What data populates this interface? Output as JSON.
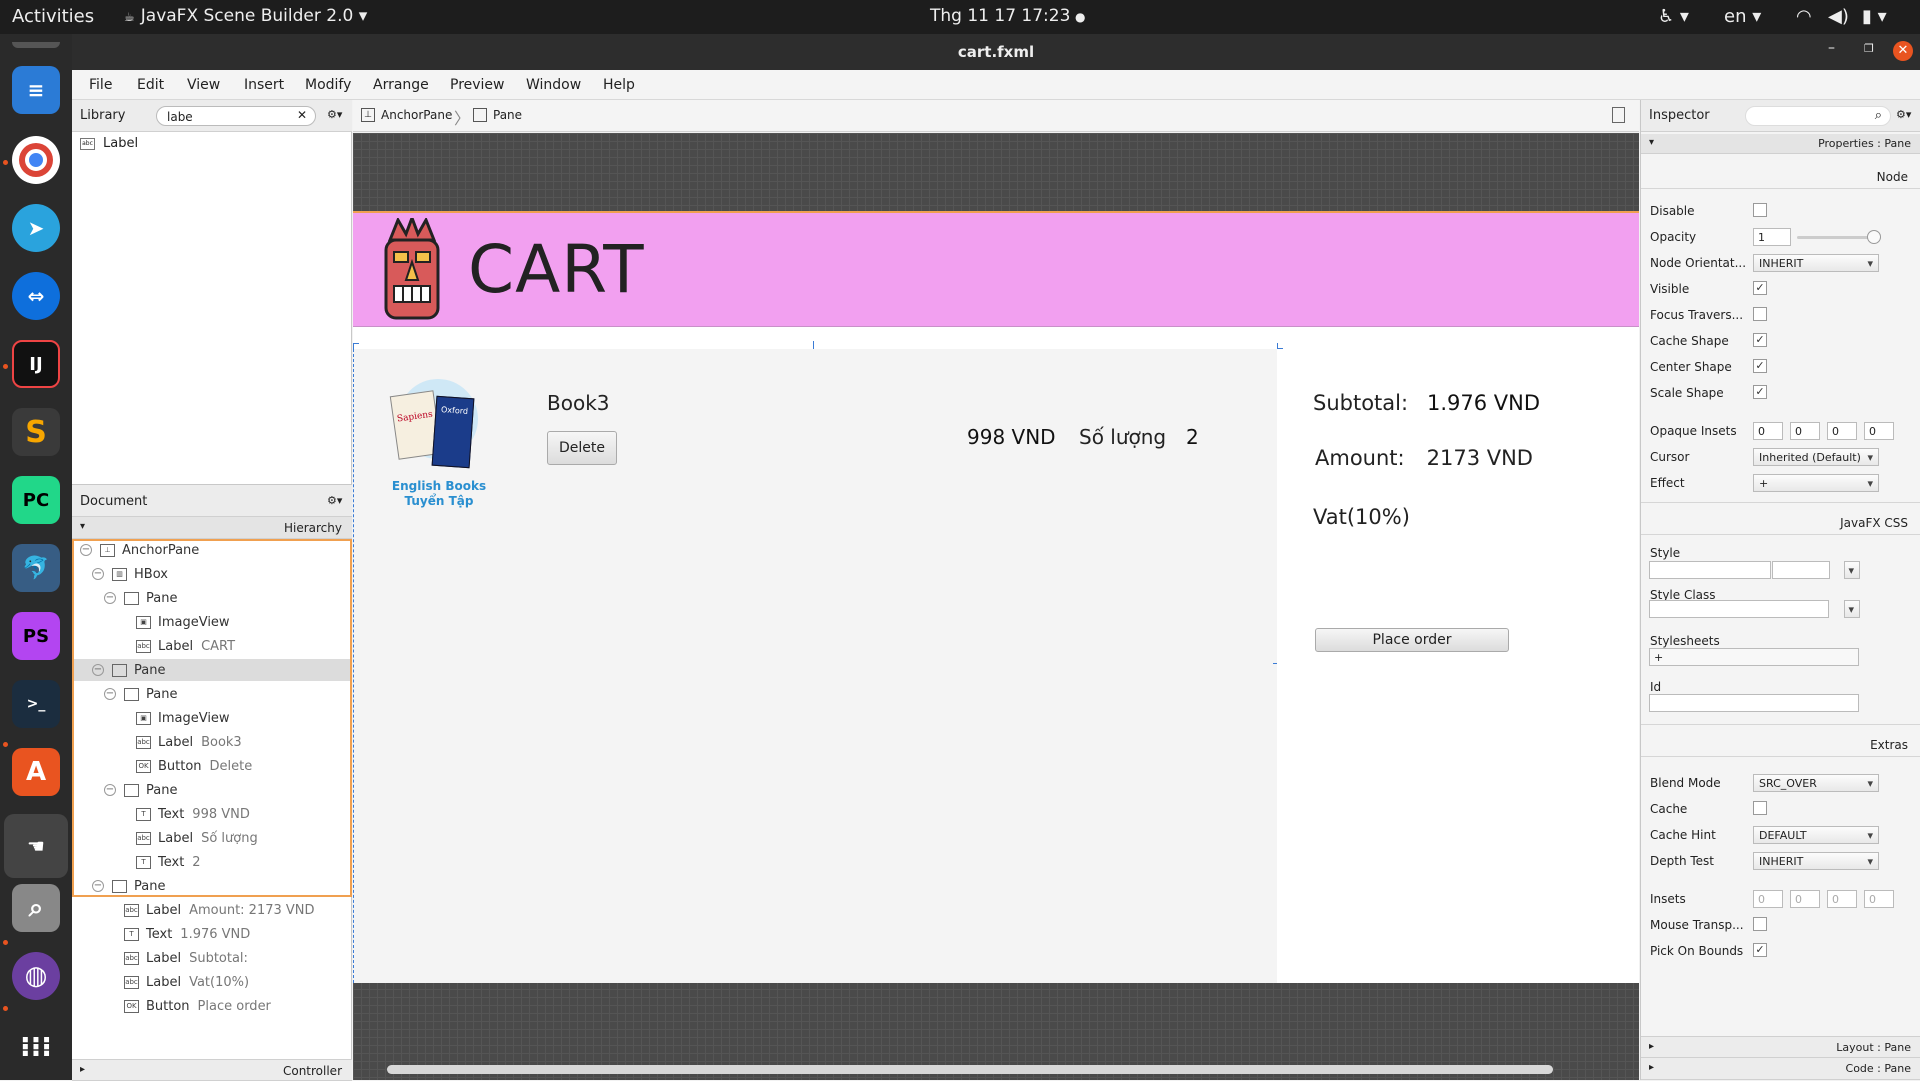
{
  "topbar": {
    "activities": "Activities",
    "app_name": "JavaFX Scene Builder 2.0",
    "app_arrow": "▾",
    "clock": "Thg 11 17  17:23",
    "lang": "en"
  },
  "window": {
    "title": "cart.fxml"
  },
  "menu": [
    "File",
    "Edit",
    "View",
    "Insert",
    "Modify",
    "Arrange",
    "Preview",
    "Window",
    "Help"
  ],
  "library": {
    "title": "Library",
    "search_value": "labe",
    "results": [
      "Label"
    ]
  },
  "document": {
    "title": "Document",
    "hierarchy": "Hierarchy",
    "controller": "Controller",
    "tree": [
      {
        "indent": 0,
        "toggle": "−",
        "icon": "AnchorPane",
        "label": "AnchorPane",
        "sub": ""
      },
      {
        "indent": 1,
        "toggle": "−",
        "icon": "HBox",
        "label": "HBox",
        "sub": ""
      },
      {
        "indent": 2,
        "toggle": "−",
        "icon": "Pane",
        "label": "Pane",
        "sub": ""
      },
      {
        "indent": 3,
        "toggle": "",
        "icon": "ImageView",
        "label": "ImageView",
        "sub": ""
      },
      {
        "indent": 3,
        "toggle": "",
        "icon": "Label",
        "label": "Label",
        "sub": "CART"
      },
      {
        "indent": 1,
        "toggle": "−",
        "icon": "Pane",
        "label": "Pane",
        "sub": "",
        "selected": true
      },
      {
        "indent": 2,
        "toggle": "−",
        "icon": "Pane",
        "label": "Pane",
        "sub": ""
      },
      {
        "indent": 3,
        "toggle": "",
        "icon": "ImageView",
        "label": "ImageView",
        "sub": ""
      },
      {
        "indent": 3,
        "toggle": "",
        "icon": "Label",
        "label": "Label",
        "sub": "Book3"
      },
      {
        "indent": 3,
        "toggle": "",
        "icon": "Button",
        "label": "Button",
        "sub": "Delete"
      },
      {
        "indent": 2,
        "toggle": "−",
        "icon": "Pane",
        "label": "Pane",
        "sub": ""
      },
      {
        "indent": 3,
        "toggle": "",
        "icon": "Text",
        "label": "Text",
        "sub": "998 VND"
      },
      {
        "indent": 3,
        "toggle": "",
        "icon": "Label",
        "label": "Label",
        "sub": "Số lượng"
      },
      {
        "indent": 3,
        "toggle": "",
        "icon": "Text",
        "label": "Text",
        "sub": "2"
      },
      {
        "indent": 1,
        "toggle": "−",
        "icon": "Pane",
        "label": "Pane",
        "sub": ""
      },
      {
        "indent": 2,
        "toggle": "",
        "icon": "Label",
        "label": "Label",
        "sub": "Amount:    2173 VND"
      },
      {
        "indent": 2,
        "toggle": "",
        "icon": "Text",
        "label": "Text",
        "sub": "1.976 VND"
      },
      {
        "indent": 2,
        "toggle": "",
        "icon": "Label",
        "label": "Label",
        "sub": "Subtotal:"
      },
      {
        "indent": 2,
        "toggle": "",
        "icon": "Label",
        "label": "Label",
        "sub": "Vat(10%)"
      },
      {
        "indent": 2,
        "toggle": "",
        "icon": "Button",
        "label": "Button",
        "sub": "Place order"
      }
    ]
  },
  "breadcrumb": [
    "AnchorPane",
    "Pane"
  ],
  "canvas": {
    "header_title": "CART",
    "book_title": "Book3",
    "book_cover_text": "English Books",
    "book_cover_text2": "Tuyển Tập",
    "delete_button": "Delete",
    "price": "998 VND",
    "quantity_label": "Số lượng",
    "quantity": "2",
    "subtotal_label": "Subtotal:",
    "subtotal_value": "1.976 VND",
    "amount_label": "Amount:",
    "amount_value": "2173 VND",
    "vat_label": "Vat(10%)",
    "place_order_button": "Place order",
    "header_color": "#f2a0f0"
  },
  "inspector": {
    "title": "Inspector",
    "properties_tab": "Properties : Pane",
    "layout_tab": "Layout : Pane",
    "code_tab": "Code : Pane",
    "sections": {
      "node": "Node",
      "css": "JavaFX CSS",
      "extras": "Extras"
    },
    "props": {
      "disable": "Disable",
      "opacity": "Opacity",
      "opacity_value": "1",
      "node_orientation": "Node Orientat...",
      "node_orientation_value": "INHERIT",
      "visible": "Visible",
      "focus": "Focus Travers...",
      "cache_shape": "Cache Shape",
      "center_shape": "Center Shape",
      "scale_shape": "Scale Shape",
      "opaque_insets": "Opaque Insets",
      "inset_values": [
        "0",
        "0",
        "0",
        "0"
      ],
      "cursor": "Cursor",
      "cursor_value": "Inherited (Default)",
      "effect": "Effect",
      "effect_value": "+",
      "style": "Style",
      "style_class": "Style Class",
      "stylesheets": "Stylesheets",
      "stylesheets_value": "+",
      "id": "Id",
      "blend_mode": "Blend Mode",
      "blend_mode_value": "SRC_OVER",
      "cache": "Cache",
      "cache_hint": "Cache Hint",
      "cache_hint_value": "DEFAULT",
      "depth_test": "Depth Test",
      "depth_test_value": "INHERIT",
      "insets": "Insets",
      "insets_values": [
        "0",
        "0",
        "0",
        "0"
      ],
      "mouse_transp": "Mouse Transp...",
      "pick_on_bounds": "Pick On Bounds"
    }
  }
}
